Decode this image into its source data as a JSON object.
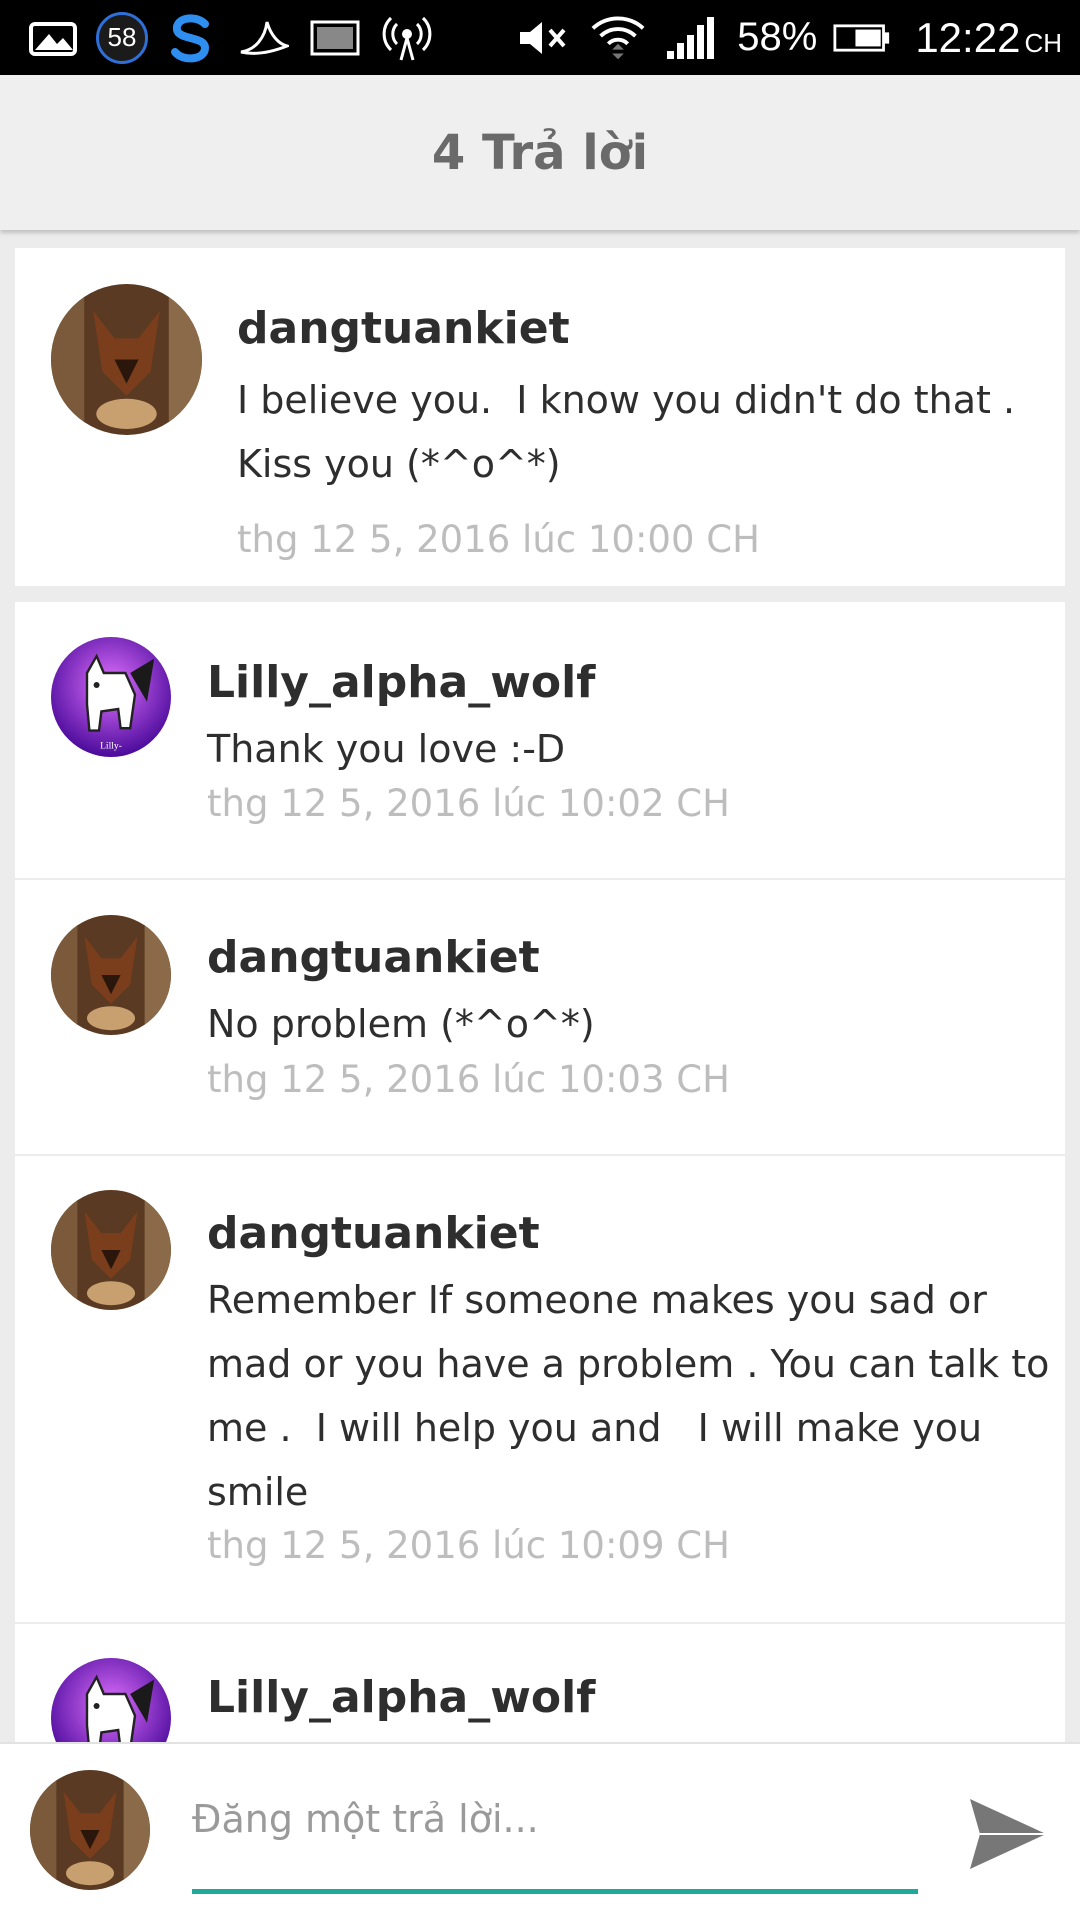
{
  "status_bar": {
    "notification_count": "58",
    "battery_percent": "58%",
    "time": "12:22",
    "time_suffix": "CH",
    "icons": [
      "gallery-icon",
      "notification-badge",
      "s-logo-icon",
      "swallow-icon",
      "image-icon",
      "hotspot-icon",
      "mute-icon",
      "wifi-icon",
      "signal-icon",
      "battery-icon"
    ]
  },
  "header": {
    "title": "4 Trả lời"
  },
  "comments": [
    {
      "author": "dangtuankiet",
      "avatar": "wolf-avatar",
      "message": "I believe you.  I know you didn't do that .\nKiss you (*^o^*)",
      "time": "thg 12 5, 2016 lúc 10:00 CH"
    },
    {
      "author": "Lilly_alpha_wolf",
      "avatar": "white-wolf-avatar",
      "avatar_caption": "Lilly-",
      "message": "Thank you love :-D",
      "time": "thg 12 5, 2016 lúc 10:02 CH"
    },
    {
      "author": "dangtuankiet",
      "avatar": "wolf-avatar",
      "message": "No problem (*^o^*)",
      "time": "thg 12 5, 2016 lúc 10:03 CH"
    },
    {
      "author": "dangtuankiet",
      "avatar": "wolf-avatar",
      "message": "Remember If someone makes you sad or\nmad or you have a problem . You can talk to\nme .  I will help you and   I will make you\nsmile",
      "time": "thg 12 5, 2016 lúc 10:09 CH"
    },
    {
      "author": "Lilly_alpha_wolf",
      "avatar": "white-wolf-avatar"
    }
  ],
  "composer": {
    "placeholder": "Đăng một trả lời...",
    "value": "",
    "accent_color": "#1fa99a",
    "send_icon": "send-icon"
  }
}
